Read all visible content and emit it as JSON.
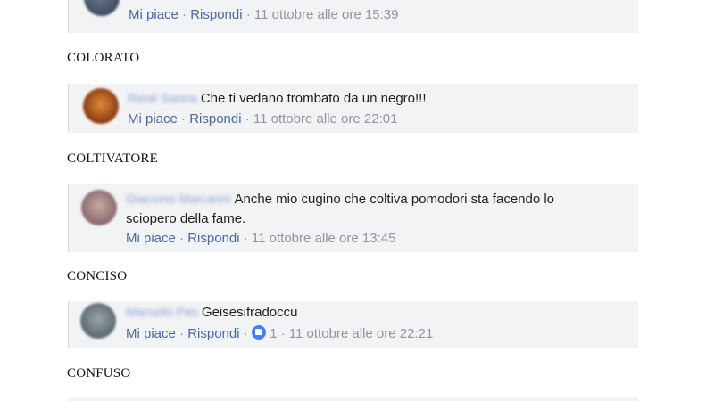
{
  "comments": [
    {
      "name": "",
      "text": "",
      "like": "Mi piace",
      "reply": "Rispondi",
      "reactions": "",
      "time": "11 ottobre alle ore 15:39"
    },
    {
      "heading": "COLORATO",
      "name": "René Sanna",
      "text": "Che ti vedano trombato da un negro!!!",
      "like": "Mi piace",
      "reply": "Rispondi",
      "reactions": "",
      "time": "11 ottobre alle ore 22:01"
    },
    {
      "heading": "COLTIVATORE",
      "name": "Giacomo Marcarini",
      "text": "Anche mio cugino che coltiva pomodori sta facendo lo",
      "text2": "sciopero della fame.",
      "like": "Mi piace",
      "reply": "Rispondi",
      "reactions": "",
      "time": "11 ottobre alle ore 13:45"
    },
    {
      "heading": "CONCISO",
      "name": "Marcello Pes",
      "text": "Geisesifradoccu",
      "like": "Mi piace",
      "reply": "Rispondi",
      "reactions": "1",
      "time": "11 ottobre alle ore 22:21"
    }
  ],
  "last_heading": "CONFUSO",
  "separator": " · "
}
